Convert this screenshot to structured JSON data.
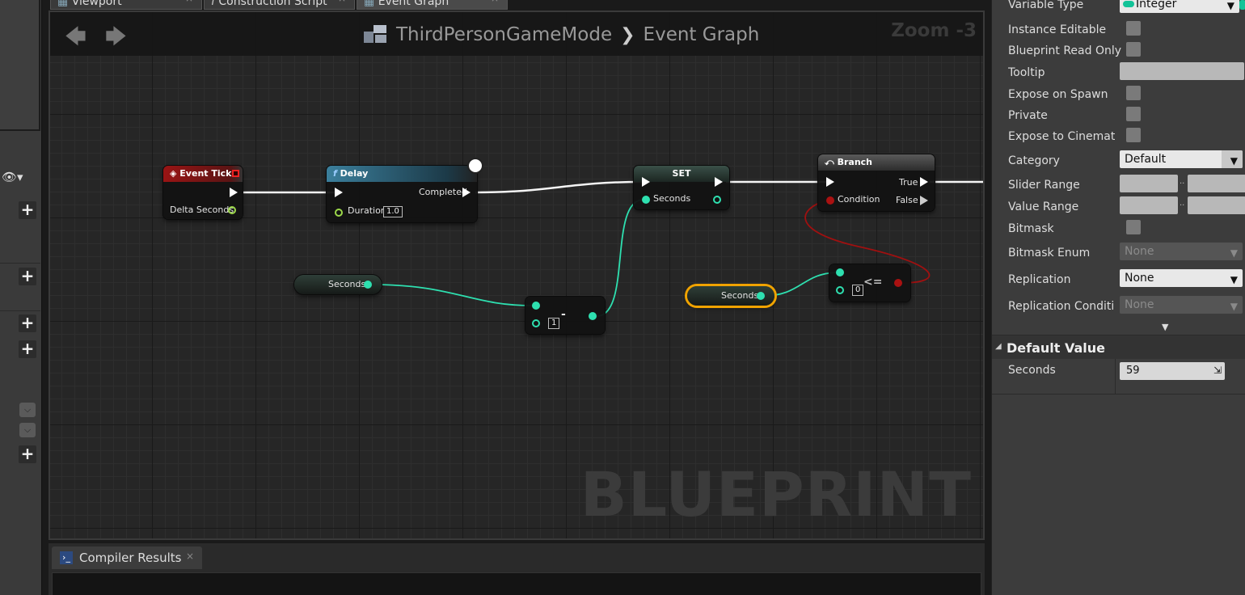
{
  "tabs": [
    {
      "label": "Viewport"
    },
    {
      "label": "Construction Script"
    },
    {
      "label": "Event Graph"
    }
  ],
  "graph": {
    "breadcrumb": {
      "blueprint": "ThirdPersonGameMode",
      "graph": "Event Graph"
    },
    "zoom": "Zoom -3",
    "watermark": "BLUEPRINT",
    "nodes": {
      "event_tick": {
        "title": "Event Tick",
        "pin": "Delta Seconds"
      },
      "delay": {
        "title": "Delay",
        "completed": "Completed",
        "duration_label": "Duration",
        "duration_value": "1.0"
      },
      "set": {
        "title": "SET",
        "pin": "Seconds"
      },
      "branch": {
        "title": "Branch",
        "condition": "Condition",
        "true": "True",
        "false": "False"
      },
      "get_seconds_1": {
        "label": "Seconds"
      },
      "get_seconds_2": {
        "label": "Seconds"
      },
      "subtract": {
        "operator": "-",
        "value": "1"
      },
      "lte": {
        "operator": "<=",
        "value": "0"
      }
    }
  },
  "bottom": {
    "tab": "Compiler Results"
  },
  "details": {
    "rows": [
      {
        "label": "Variable Type",
        "type": "dropdown",
        "value": "Integer"
      },
      {
        "label": "Instance Editable",
        "type": "checkbox"
      },
      {
        "label": "Blueprint Read Only",
        "type": "checkbox"
      },
      {
        "label": "Tooltip",
        "type": "text"
      },
      {
        "label": "Expose on Spawn",
        "type": "checkbox"
      },
      {
        "label": "Private",
        "type": "checkbox"
      },
      {
        "label": "Expose to Cinematics",
        "type": "checkbox"
      },
      {
        "label": "Category",
        "type": "dropdown",
        "value": "Default"
      },
      {
        "label": "Slider Range",
        "type": "range"
      },
      {
        "label": "Value Range",
        "type": "range"
      },
      {
        "label": "Bitmask",
        "type": "checkbox"
      },
      {
        "label": "Bitmask Enum",
        "type": "dropdown",
        "value": "None"
      },
      {
        "label": "Replication",
        "type": "dropdown",
        "value": "None"
      },
      {
        "label": "Replication Condition",
        "type": "dropdown",
        "value": "None"
      }
    ],
    "range_separator": "..",
    "default_value": {
      "title": "Default Value",
      "label": "Seconds",
      "value": "59"
    }
  },
  "colors": {
    "int_pin": "#2ee0b0",
    "bool_pin": "#a11111",
    "event_header": "#8a1010",
    "function_header": "#2a5a70",
    "selected_outline": "#f0a300"
  }
}
